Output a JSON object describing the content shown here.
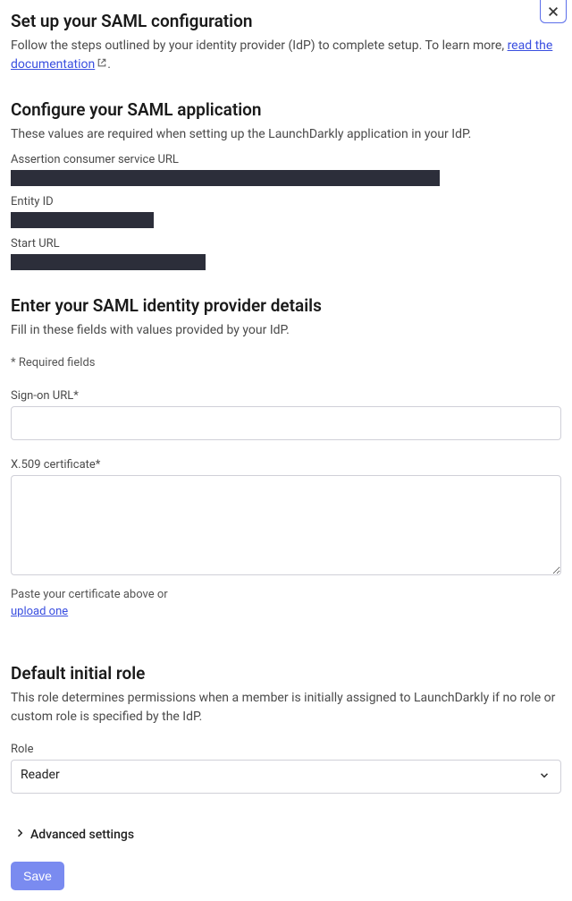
{
  "header": {
    "title": "Set up your SAML configuration",
    "desc_prefix": "Follow the steps outlined by your identity provider (IdP) to complete setup. To learn more, ",
    "doc_link": "read the documentation",
    "desc_suffix": "."
  },
  "configure": {
    "title": "Configure your SAML application",
    "desc": "These values are required when setting up the LaunchDarkly application in your IdP.",
    "fields": {
      "acs_label": "Assertion consumer service URL",
      "entity_label": "Entity ID",
      "start_label": "Start URL"
    }
  },
  "idp": {
    "title": "Enter your SAML identity provider details",
    "desc": "Fill in these fields with values provided by your IdP.",
    "required_note": "* Required fields",
    "signon_label": "Sign-on URL*",
    "cert_label": "X.509 certificate*",
    "cert_helper": "Paste your certificate above or",
    "upload_link": "upload one"
  },
  "role": {
    "title": "Default initial role",
    "desc": "This role determines permissions when a member is initially assigned to LaunchDarkly if no role or custom role is specified by the IdP.",
    "label": "Role",
    "selected": "Reader"
  },
  "advanced": {
    "label": "Advanced settings"
  },
  "footer": {
    "save": "Save"
  }
}
